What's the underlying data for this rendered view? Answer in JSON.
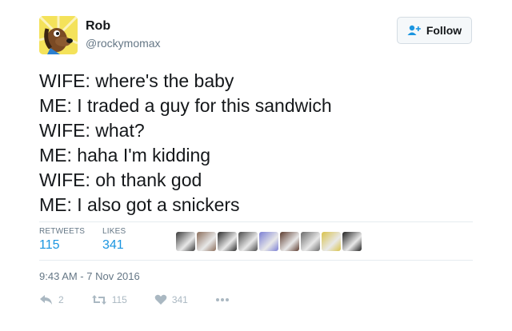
{
  "user": {
    "name": "Rob",
    "handle": "@rockymomax",
    "follow_label": "Follow"
  },
  "tweet": {
    "lines": [
      "WIFE: where's the baby",
      "ME: I traded a guy for this sandwich",
      "WIFE: what?",
      "ME: haha I'm kidding",
      "WIFE: oh thank god",
      "ME: I also got a snickers"
    ]
  },
  "stats": {
    "retweets_label": "RETWEETS",
    "retweets": "115",
    "likes_label": "LIKES",
    "likes": "341"
  },
  "likers": [
    {
      "icon": "liker-avatar-1",
      "color": "#3a3a3a"
    },
    {
      "icon": "liker-avatar-2",
      "color": "#8a6d5a"
    },
    {
      "icon": "liker-avatar-3",
      "color": "#2c2c2c"
    },
    {
      "icon": "liker-avatar-4",
      "color": "#4b4b4b"
    },
    {
      "icon": "liker-avatar-5",
      "color": "#7b7fd4"
    },
    {
      "icon": "liker-avatar-6",
      "color": "#5c3b2e"
    },
    {
      "icon": "liker-avatar-7",
      "color": "#6b6b6b"
    },
    {
      "icon": "liker-avatar-8",
      "color": "#d9c24a"
    },
    {
      "icon": "liker-avatar-9",
      "color": "#1f1f1f"
    }
  ],
  "timestamp": "9:43 AM - 7 Nov 2016",
  "actions": {
    "reply_count": "2",
    "retweet_count": "115",
    "like_count": "341"
  },
  "colors": {
    "accent": "#1b95e0",
    "muted": "#657786",
    "icon_gray": "#aab8c2"
  }
}
